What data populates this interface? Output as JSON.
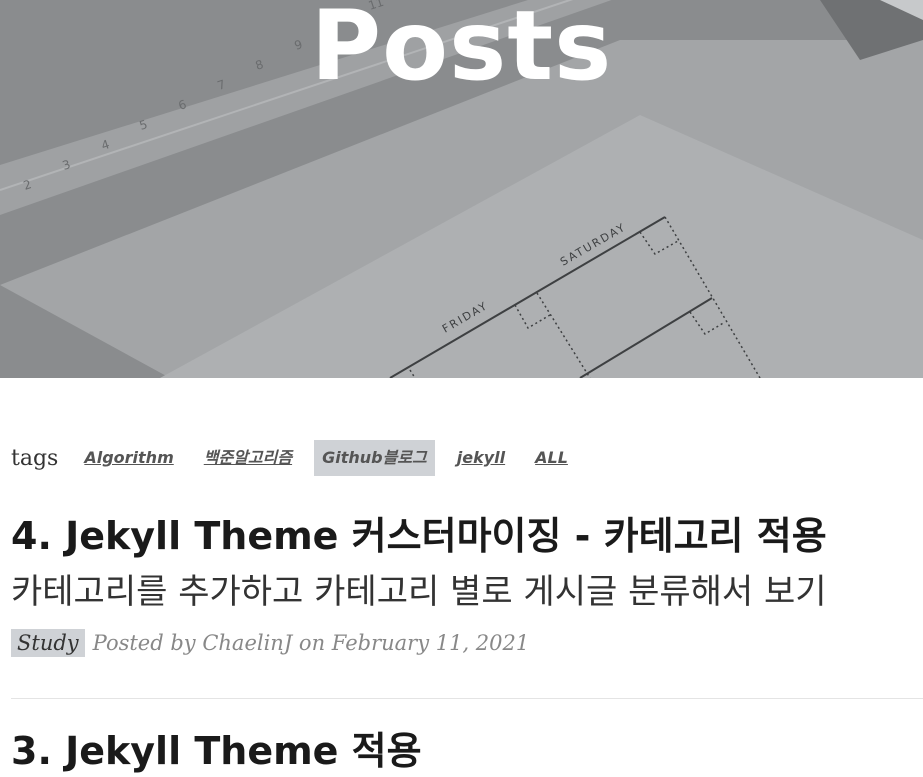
{
  "hero": {
    "title": "Posts",
    "background_color": "#8c8e90"
  },
  "tags": {
    "label": "tags",
    "items": [
      {
        "label": "Algorithm",
        "active": false
      },
      {
        "label": "백준알고리즘",
        "active": false
      },
      {
        "label": "Github블로그",
        "active": true
      },
      {
        "label": "jekyll",
        "active": false
      },
      {
        "label": "ALL",
        "active": false
      }
    ]
  },
  "posts": [
    {
      "title": "4. Jekyll Theme 커스터마이징 - 카테고리 적용",
      "subtitle": "카테고리를 추가하고 카테고리 별로 게시글 분류해서 보기",
      "category": "Study",
      "meta": "Posted by ChaelinJ on February 11, 2021"
    },
    {
      "title": "3. Jekyll Theme 적용"
    }
  ]
}
